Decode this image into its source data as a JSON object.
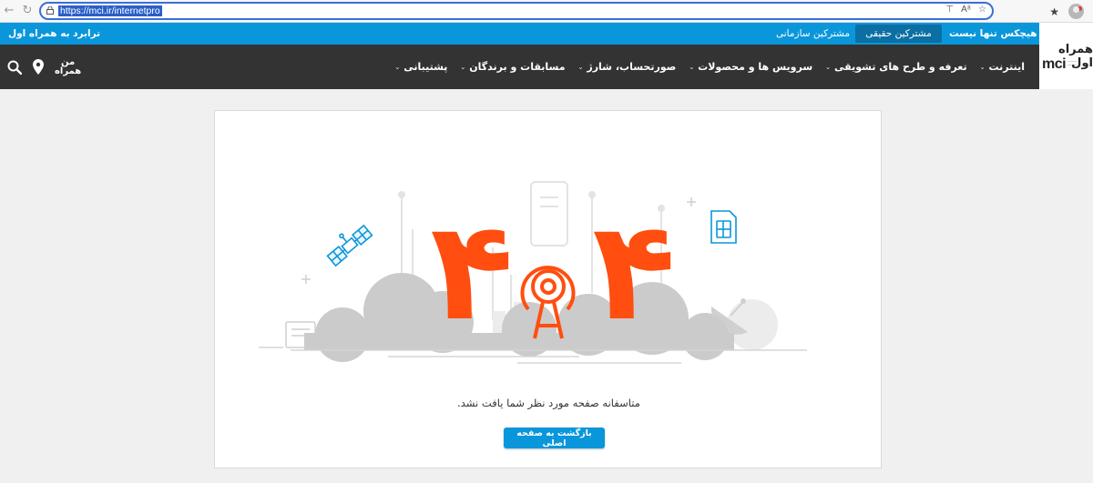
{
  "browser": {
    "url": "https://mci.ir/internetpro",
    "colors": {
      "focus": "#3b6fd8",
      "selection": "#2b5fc7"
    }
  },
  "topbar": {
    "slogan": "هیچکس تنها نیست",
    "tab_personal": "مشترکین حقیقی",
    "tab_corporate": "مشترکین سازمانی",
    "roaming": "ترابرد به همراه اول",
    "color": "#0a96db"
  },
  "nav": {
    "items": [
      {
        "label": "اینترنت"
      },
      {
        "label": "تعرفه و طرح های تشویقی"
      },
      {
        "label": "سرویس ها و محصولات"
      },
      {
        "label": "صورتحساب، شارژ"
      },
      {
        "label": "مسابقات و برندگان"
      },
      {
        "label": "پشتیبانی"
      }
    ],
    "hamrahman_top": "من",
    "hamrahman_bottom": "همراه",
    "icons": [
      "search-icon",
      "location-pin-icon"
    ],
    "color": "#333333"
  },
  "logo": {
    "fa": "همراه اول",
    "en": "mci"
  },
  "error": {
    "message": "متاسفانه صفحه مورد نظر شما یافت نشد.",
    "button": "بازگشت به صفحه اصلی",
    "digit": "۴",
    "accent": "#ff4e0f"
  }
}
